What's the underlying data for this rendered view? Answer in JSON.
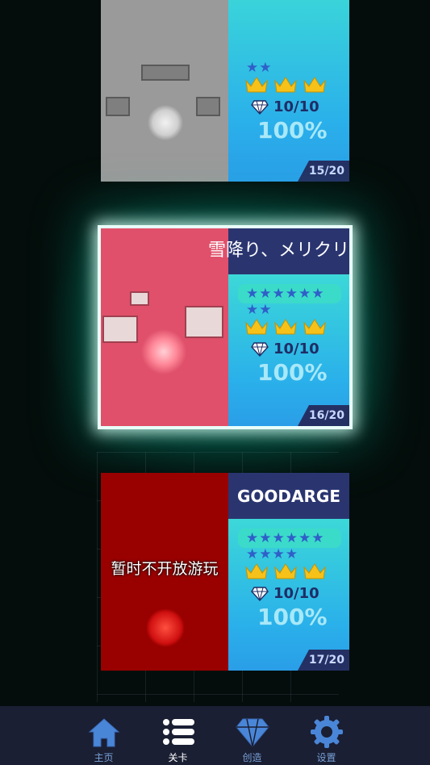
{
  "levels": [
    {
      "title": "",
      "stars_row1": "★★",
      "stars_row2": "",
      "gems": "10/10",
      "percent": "100%",
      "level_tag": "15/20",
      "locked_label": ""
    },
    {
      "title": "雪降り、メリクリ",
      "stars_row1": "★★★★★★",
      "stars_row2": "★★",
      "gems": "10/10",
      "percent": "100%",
      "level_tag": "16/20",
      "locked_label": ""
    },
    {
      "title": "GOODARGE",
      "stars_row1": "★★★★★★",
      "stars_row2": "★★★★",
      "gems": "10/10",
      "percent": "100%",
      "level_tag": "17/20",
      "locked_label": "暂时不开放游玩"
    }
  ],
  "nav": {
    "home": "主页",
    "levels": "关卡",
    "create": "创造",
    "settings": "设置",
    "active": "levels"
  },
  "colors": {
    "accent": "#2ab4e8",
    "title_bar": "#2a3570",
    "crown": "#f6c21a",
    "glow": "#00c8a0"
  }
}
